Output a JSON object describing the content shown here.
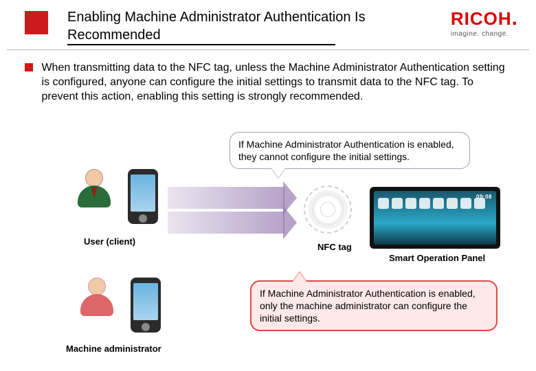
{
  "header": {
    "title": "Enabling Machine Administrator Authentication Is Recommended",
    "logo_main": "RICOH",
    "logo_sub": "imagine. change."
  },
  "body": {
    "paragraph": "When transmitting data to the NFC tag, unless the Machine Administrator Authentication setting is configured, anyone can configure the initial settings to transmit data to the NFC tag. To prevent this action, enabling this setting is strongly recommended."
  },
  "callouts": {
    "top": "If Machine Administrator Authentication is enabled, they cannot configure the initial settings.",
    "bottom": "If Machine Administrator Authentication is enabled, only the machine administrator can configure the initial settings."
  },
  "labels": {
    "user": "User (client)",
    "nfc": "NFC tag",
    "panel": "Smart Operation Panel",
    "admin": "Machine administrator"
  },
  "panel": {
    "time": "09:08"
  }
}
